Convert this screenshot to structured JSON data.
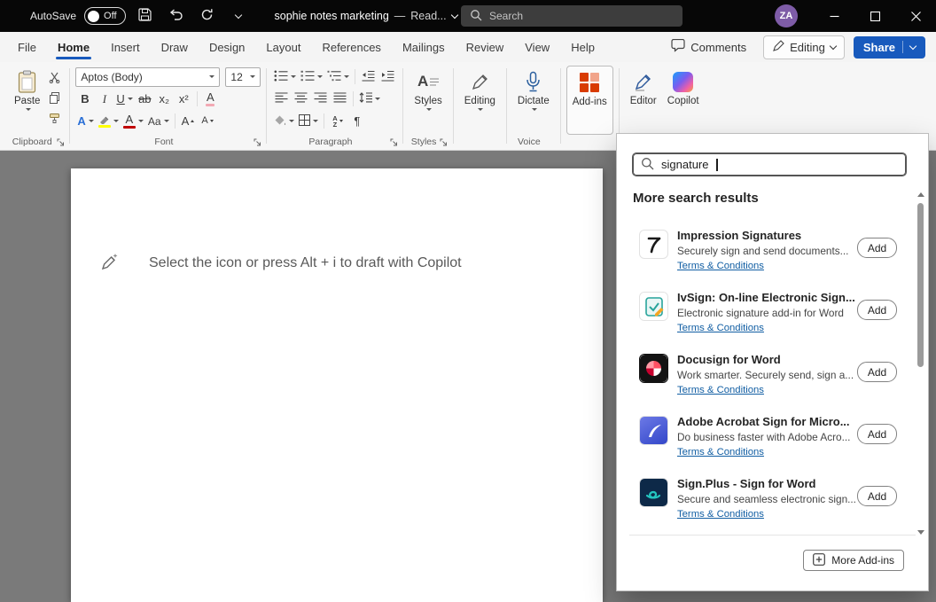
{
  "titlebar": {
    "autosave_label": "AutoSave",
    "autosave_state": "Off",
    "title": "sophie notes marketing",
    "separator": "—",
    "mode": "Read...",
    "search_placeholder": "Search",
    "avatar": "ZA"
  },
  "menubar": {
    "tabs": [
      "File",
      "Home",
      "Insert",
      "Draw",
      "Design",
      "Layout",
      "References",
      "Mailings",
      "Review",
      "View",
      "Help"
    ],
    "active_tab": "Home",
    "comments": "Comments",
    "editing": "Editing",
    "share": "Share"
  },
  "ribbon": {
    "paste": "Paste",
    "font_name": "Aptos (Body)",
    "font_size": "12",
    "styles": "Styles",
    "editing": "Editing",
    "dictate": "Dictate",
    "addins": "Add-ins",
    "editor": "Editor",
    "copilot": "Copilot",
    "group_clipboard": "Clipboard",
    "group_font": "Font",
    "group_paragraph": "Paragraph",
    "group_styles": "Styles",
    "group_voice": "Voice"
  },
  "glyphs": {
    "bold": "B",
    "italic": "I",
    "underline": "U",
    "strikethrough": "ab",
    "subscript": "x₂",
    "superscript": "x²",
    "clear_formatting": "A",
    "text_effects": "A",
    "font_color": "A",
    "change_case": "Aa",
    "grow_font": "A",
    "shrink_font": "A",
    "pilcrow": "¶",
    "sort_a": "A",
    "sort_z": "Z",
    "styles_a": "A"
  },
  "document": {
    "placeholder": "Select the icon or press Alt + i to draft with Copilot"
  },
  "addins": {
    "search_value": "signature",
    "heading": "More search results",
    "add_label": "Add",
    "terms_label": "Terms & Conditions",
    "more_label": "More Add-ins",
    "items": [
      {
        "name": "Impression Signatures",
        "desc": "Securely sign and send documents..."
      },
      {
        "name": "IvSign: On-line Electronic Sign...",
        "desc": "Electronic signature add-in for Word"
      },
      {
        "name": "Docusign for Word",
        "desc": "Work smarter. Securely send, sign a..."
      },
      {
        "name": "Adobe Acrobat Sign for Micro...",
        "desc": "Do business faster with Adobe Acro..."
      },
      {
        "name": "Sign.Plus - Sign for Word",
        "desc": "Secure and seamless electronic sign..."
      }
    ]
  },
  "colors": {
    "accent_blue": "#185abd",
    "link_blue": "#115ea3",
    "addins_orange": "#d83b01",
    "highlight_yellow": "#ffff00",
    "font_color_red": "#c00000"
  }
}
